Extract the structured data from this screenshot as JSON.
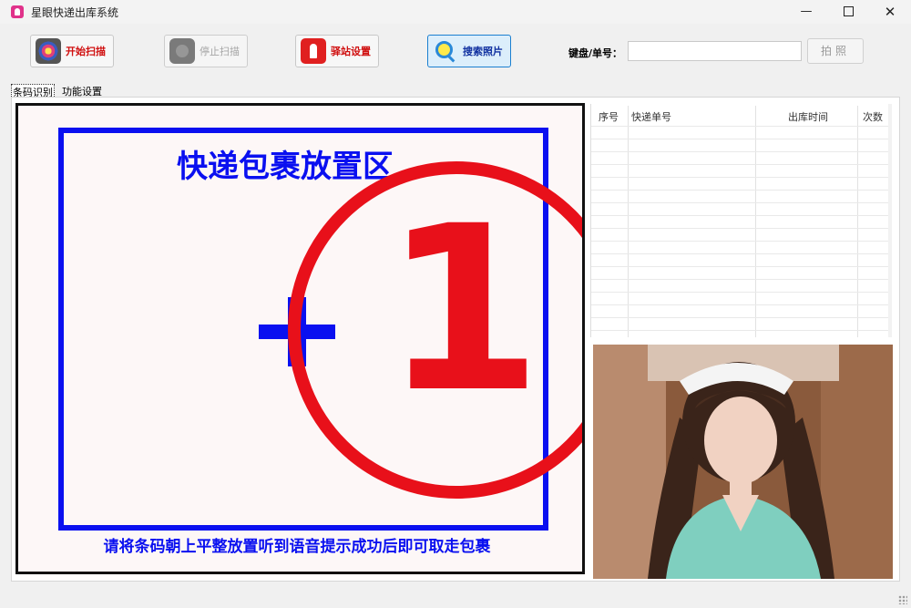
{
  "window": {
    "title": "星眼快递出库系统",
    "minimize": "—",
    "close": "✕"
  },
  "toolbar": {
    "start_scan": "开始扫描",
    "stop_scan": "停止扫描",
    "station_settings": "驿站设置",
    "search_photos": "搜索照片",
    "barcode_label": "键盘/单号：",
    "barcode_value": "",
    "photo_button": "拍照"
  },
  "tabs": [
    "条码识别",
    "功能设置"
  ],
  "scan_area": {
    "title": "快递包裹放置区",
    "instruction": "请将条码朝上平整放置听到语音提示成功后即可取走包裹",
    "badge_number": "1",
    "colors": {
      "frame": "#0a10f0",
      "badge": "#e8101a"
    }
  },
  "table": {
    "columns": [
      "序号",
      "快递单号",
      "出库时间",
      "次数"
    ],
    "rows": []
  },
  "photo": {
    "icon": "camera-preview-photo"
  }
}
